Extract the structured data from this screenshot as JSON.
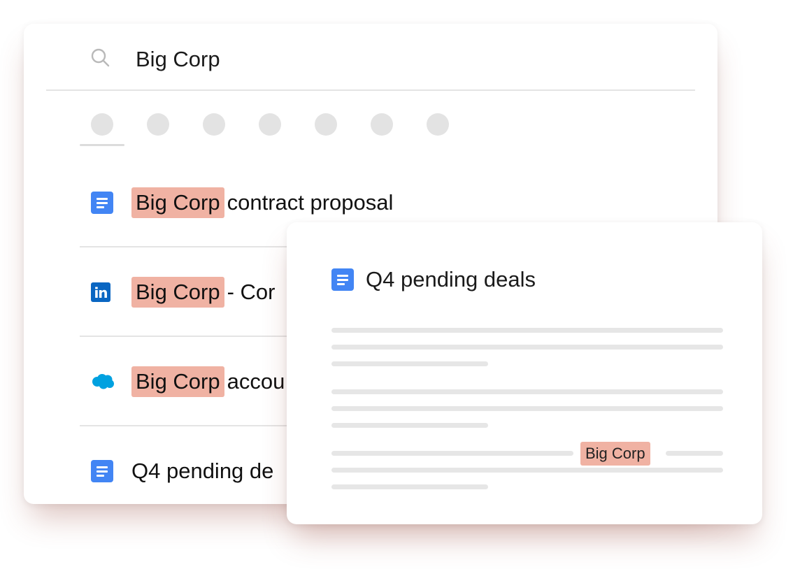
{
  "search": {
    "query": "Big Corp",
    "icon": "search-icon"
  },
  "filters": {
    "count": 7,
    "active_index": 0
  },
  "results": [
    {
      "icon": "google-docs-icon",
      "highlight": "Big Corp",
      "rest": "contract proposal"
    },
    {
      "icon": "linkedin-icon",
      "highlight": "Big Corp",
      "rest": "- Cor"
    },
    {
      "icon": "salesforce-icon",
      "highlight": "Big Corp",
      "rest": "accou"
    },
    {
      "icon": "google-docs-icon",
      "highlight": "",
      "rest": "Q4 pending de"
    }
  ],
  "preview": {
    "icon": "google-docs-icon",
    "title": "Q4 pending deals",
    "inline_highlight": "Big Corp"
  },
  "colors": {
    "highlight": "#f0b2a3",
    "docs_blue": "#4285f4",
    "linkedin_blue": "#0a66c2",
    "salesforce_blue": "#00a1e0"
  }
}
